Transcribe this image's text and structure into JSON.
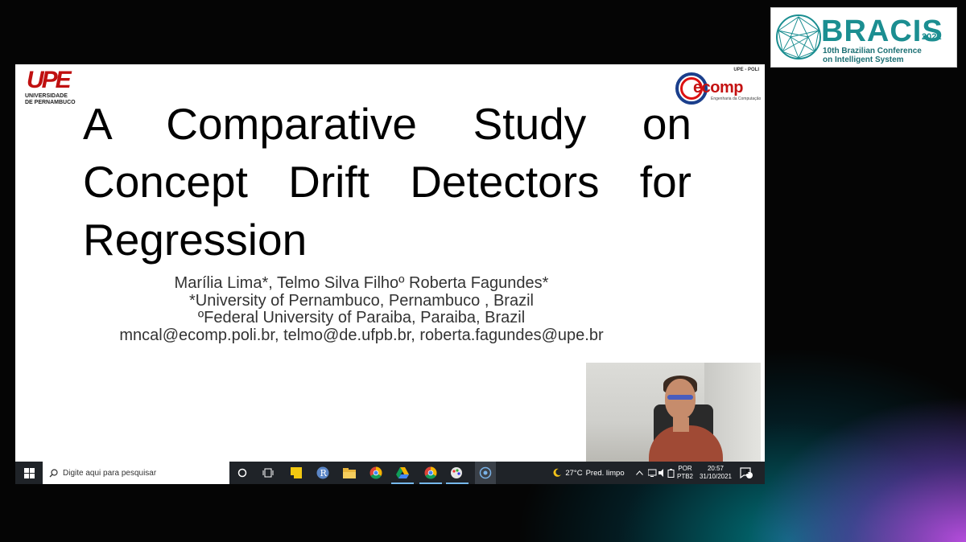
{
  "conference_logo": {
    "wordmark": "BRACIS",
    "year": "2021",
    "subtitle_line1": "10th Brazilian Conference",
    "subtitle_line2": "on Intelligent System"
  },
  "slide": {
    "left_logo": {
      "mark": "UPE",
      "line1": "UNIVERSIDADE",
      "line2": "DE PERNAMBUCO"
    },
    "right_logo": {
      "top_text": "UPE - POLI",
      "mark": "ecomp",
      "caption": "Engenharia da Computação"
    },
    "title_lines": [
      "A Comparative Study on",
      "Concept Drift Detectors for",
      "Regression"
    ],
    "authors": "Marília Lima*, Telmo Silva Filhoº Roberta Fagundes*",
    "affiliation1": "*University of Pernambuco, Pernambuco , Brazil",
    "affiliation2": "ºFederal University of Paraiba, Paraiba, Brazil",
    "emails": "mncal@ecomp.poli.br, telmo@de.ufpb.br, roberta.fagundes@upe.br"
  },
  "taskbar": {
    "search_placeholder": "Digite aqui para pesquisar",
    "apps": [
      "cortana-icon",
      "task-view-icon",
      "sticky-notes-icon",
      "r-icon",
      "file-explorer-icon",
      "chrome-icon",
      "google-drive-icon",
      "chrome-alt-icon",
      "paint-icon",
      "screen-share-icon"
    ],
    "weather_temp": "27°C",
    "weather_desc": "Pred. limpo",
    "lang_top": "POR",
    "lang_bottom": "PTB2",
    "time": "20:57",
    "date": "31/10/2021",
    "notification_count": "1"
  }
}
